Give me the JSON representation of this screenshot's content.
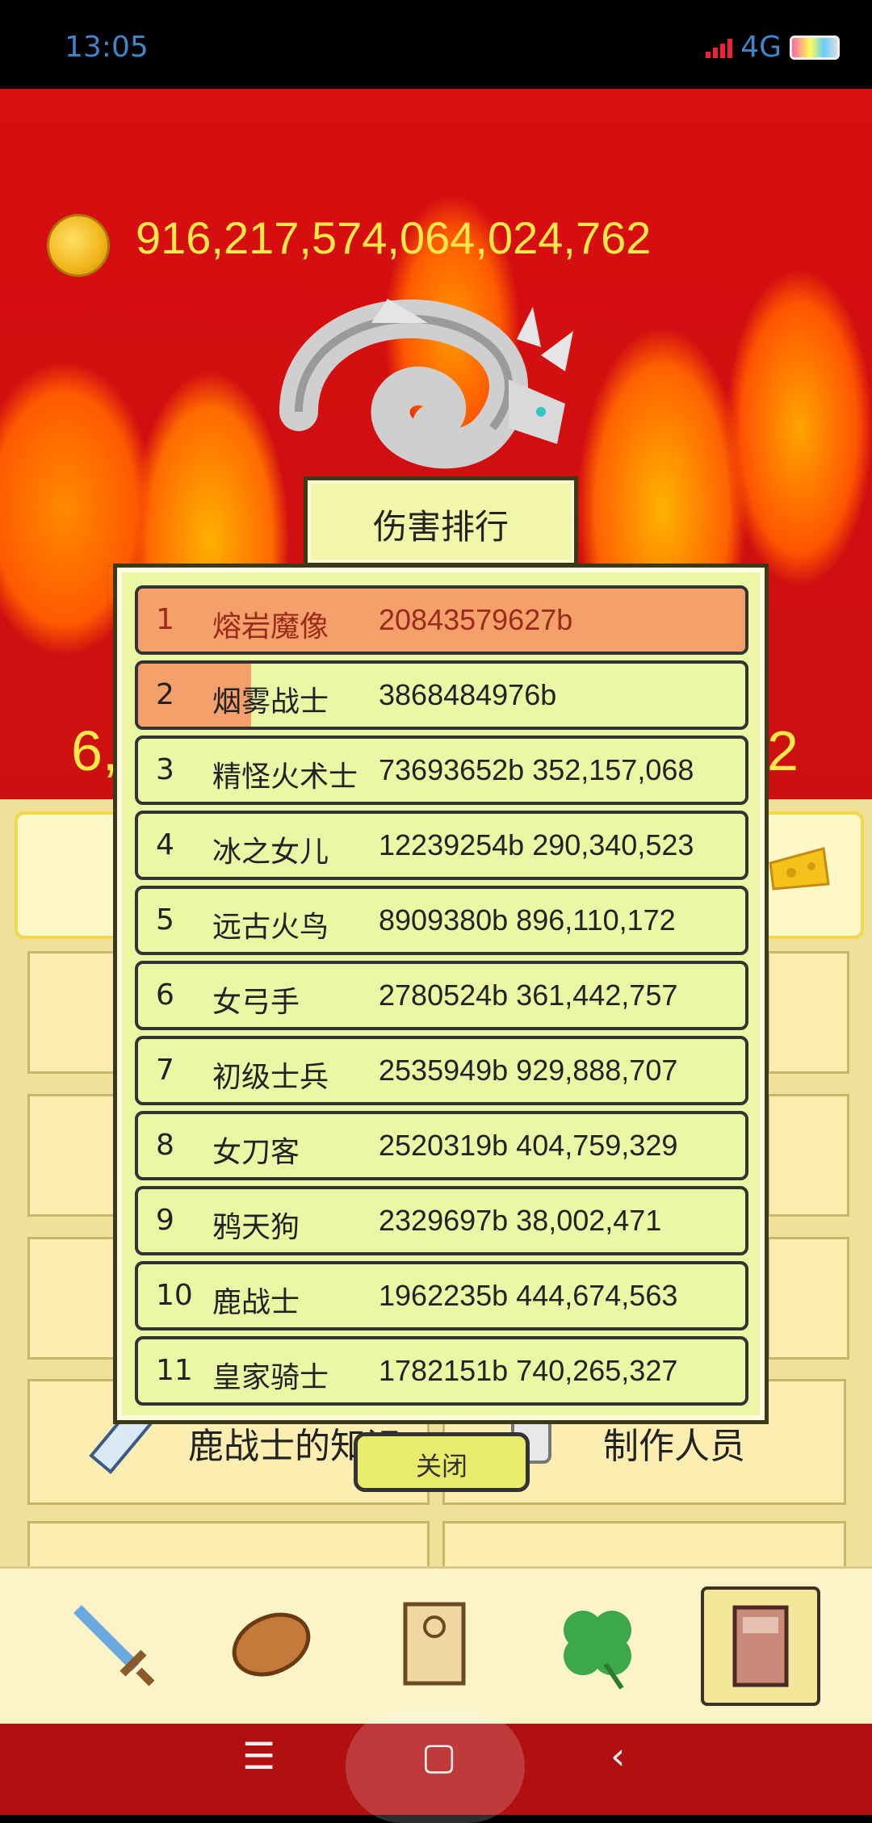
{
  "status_bar": {
    "time": "13:05",
    "network": "4G"
  },
  "gold": {
    "amount": "916,217,574,064,024,762"
  },
  "background_numbers": {
    "left": "6,",
    "right": "2"
  },
  "menu": {
    "tiles": [
      {
        "label": "鹿战士的知识",
        "icon": "book-icon"
      },
      {
        "label": "制作人员",
        "icon": "mug-icon"
      }
    ]
  },
  "bottom_tabs": [
    "sword-icon",
    "bread-icon",
    "scroll-icon",
    "clover-icon",
    "book-icon"
  ],
  "ranking": {
    "title": "伤害排行",
    "close_label": "关闭",
    "rows": [
      {
        "rank": "1",
        "name": "熔岩魔像",
        "value": "20843579627b",
        "fraction": 1.0
      },
      {
        "rank": "2",
        "name": "烟雾战士",
        "value": "3868484976b",
        "fraction": 0.186
      },
      {
        "rank": "3",
        "name": "精怪火术士",
        "value": "73693652b 352,157,068",
        "fraction": 0
      },
      {
        "rank": "4",
        "name": "冰之女儿",
        "value": "12239254b 290,340,523",
        "fraction": 0
      },
      {
        "rank": "5",
        "name": "远古火鸟",
        "value": "8909380b 896,110,172",
        "fraction": 0
      },
      {
        "rank": "6",
        "name": "女弓手",
        "value": "2780524b 361,442,757",
        "fraction": 0
      },
      {
        "rank": "7",
        "name": "初级士兵",
        "value": "2535949b 929,888,707",
        "fraction": 0
      },
      {
        "rank": "8",
        "name": "女刀客",
        "value": "2520319b 404,759,329",
        "fraction": 0
      },
      {
        "rank": "9",
        "name": "鸦天狗",
        "value": "2329697b 38,002,471",
        "fraction": 0
      },
      {
        "rank": "10",
        "name": "鹿战士",
        "value": "1962235b 444,674,563",
        "fraction": 0
      },
      {
        "rank": "11",
        "name": "皇家骑士",
        "value": "1782151b 740,265,327",
        "fraction": 0
      }
    ]
  },
  "nav": {
    "menu": "☰",
    "home": "▢",
    "back": "‹"
  }
}
